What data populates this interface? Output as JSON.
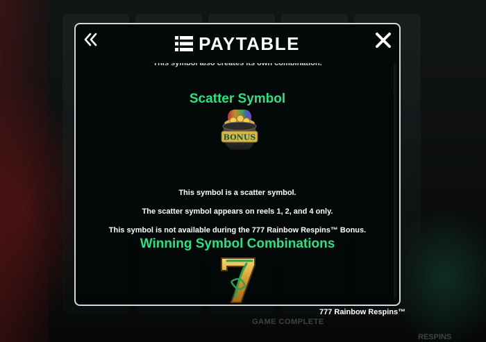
{
  "modal": {
    "title": "PAYTABLE",
    "cut_off_text": "This symbol also creates its own combination.",
    "scatter": {
      "heading": "Scatter Symbol",
      "symbol_label": "BONUS",
      "lines": [
        "This symbol is a scatter symbol.",
        "The scatter symbol appears on reels 1, 2, and 4 only.",
        "This symbol is not available during the 777 Rainbow Respins™ Bonus."
      ]
    },
    "winning": {
      "heading": "Winning Symbol Combinations"
    }
  },
  "footer": {
    "label": "777 Rainbow Respins™"
  },
  "background": {
    "bottom_label": "GAME COMPLETE",
    "bottom_right": "RESPINS"
  },
  "colors": {
    "heading_green": "#2fe082",
    "modal_border": "#d6d9da",
    "text_white": "#ffffff"
  }
}
